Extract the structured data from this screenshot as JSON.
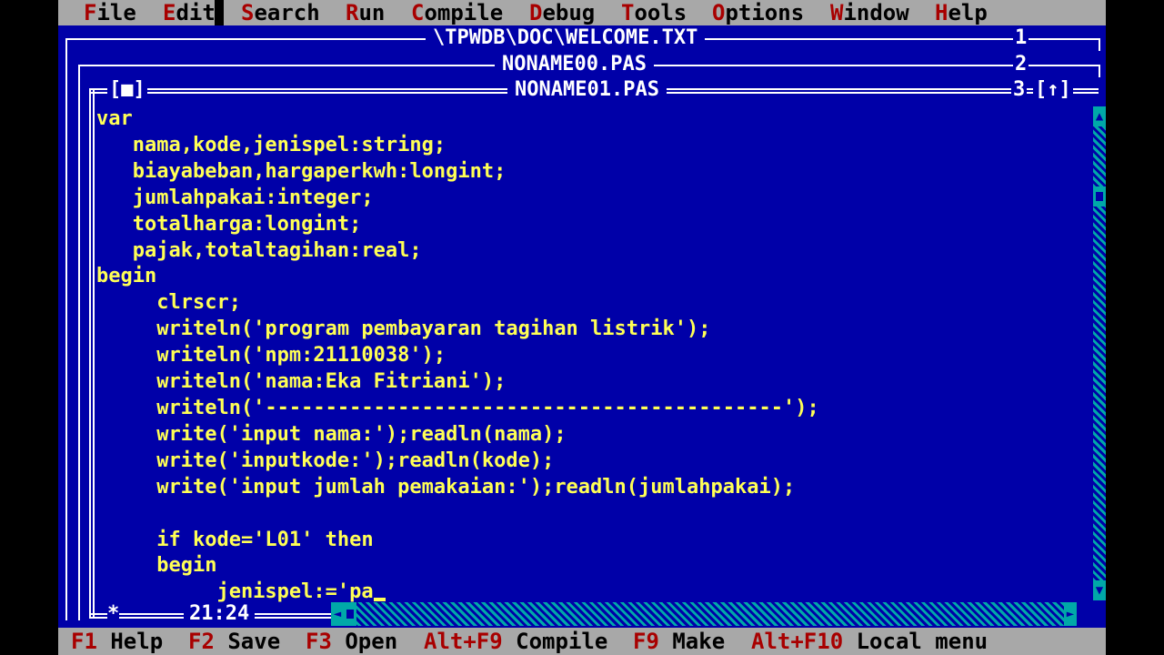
{
  "menu": {
    "items": [
      "File",
      "Edit",
      "Search",
      "Run",
      "Compile",
      "Debug",
      "Tools",
      "Options",
      "Window",
      "Help"
    ],
    "hotkeys": [
      "F",
      "E",
      "S",
      "R",
      "C",
      "D",
      "T",
      "O",
      "W",
      "H"
    ]
  },
  "windows": [
    {
      "title": "\\TPWDB\\DOC\\WELCOME.TXT",
      "number": "1"
    },
    {
      "title": "NONAME00.PAS",
      "number": "2"
    },
    {
      "title": "NONAME01.PAS",
      "number": "3"
    }
  ],
  "active_window": {
    "close_button": "[■]",
    "zoom_button": "[↑]",
    "cursor_position": "21:24",
    "modified_indicator": "*"
  },
  "editor": {
    "lines": [
      "var",
      "   nama,kode,jenispel:string;",
      "   biayabeban,hargaperkwh:longint;",
      "   jumlahpakai:integer;",
      "   totalharga:longint;",
      "   pajak,totaltagihan:real;",
      "begin",
      "     clrscr;",
      "     writeln('program pembayaran tagihan listrik');",
      "     writeln('npm:21110038');",
      "     writeln('nama:Eka Fitriani');",
      "     writeln('-------------------------------------------');",
      "     write('input nama:');readln(nama);",
      "     write('inputkode:');readln(kode);",
      "     write('input jumlah pemakaian:');readln(jumlahpakai);",
      "",
      "     if kode='L01' then",
      "     begin",
      "          jenispel:='pa"
    ]
  },
  "statusbar": [
    {
      "key": "F1",
      "label": "Help"
    },
    {
      "key": "F2",
      "label": "Save"
    },
    {
      "key": "F3",
      "label": "Open"
    },
    {
      "key": "Alt+F9",
      "label": "Compile"
    },
    {
      "key": "F9",
      "label": "Make"
    },
    {
      "key": "Alt+F10",
      "label": "Local menu"
    }
  ],
  "colors": {
    "desktop": "#0000a8",
    "code_text": "#ffff55",
    "menu_bg": "#a8a8a8",
    "hotkey": "#a80000",
    "frame": "#ffffff"
  }
}
